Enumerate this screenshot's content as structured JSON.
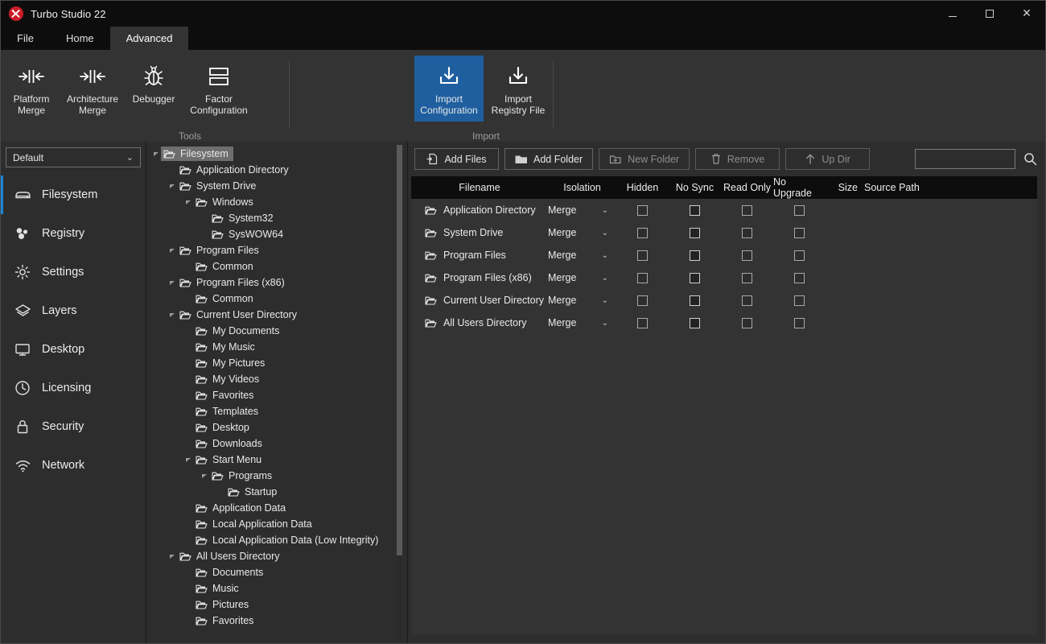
{
  "window": {
    "title": "Turbo Studio 22",
    "app_icon": "turbo-studio-icon",
    "controls": {
      "minimize": "minimize",
      "maximize": "maximize",
      "close": "close"
    }
  },
  "tabs": [
    {
      "label": "File",
      "active": false
    },
    {
      "label": "Home",
      "active": false
    },
    {
      "label": "Advanced",
      "active": true
    }
  ],
  "ribbon": {
    "groups": [
      {
        "label": "Tools",
        "buttons": [
          {
            "label_line1": "Platform",
            "label_line2": "Merge",
            "icon": "merge-icon",
            "selected": false
          },
          {
            "label_line1": "Architecture",
            "label_line2": "Merge",
            "icon": "merge-icon",
            "selected": false
          },
          {
            "label_line1": "Debugger",
            "label_line2": "",
            "icon": "bug-icon",
            "selected": false
          },
          {
            "label_line1": "Factor",
            "label_line2": "Configuration",
            "icon": "factor-icon",
            "selected": false
          }
        ]
      },
      {
        "label": "Import",
        "buttons": [
          {
            "label_line1": "Import",
            "label_line2": "Configuration",
            "icon": "import-icon",
            "selected": true
          },
          {
            "label_line1": "Import",
            "label_line2": "Registry File",
            "icon": "import-icon",
            "selected": false
          }
        ]
      }
    ]
  },
  "sidebar": {
    "profile": {
      "value": "Default",
      "caret": "chevron-down-icon"
    },
    "items": [
      {
        "label": "Filesystem",
        "icon": "drive-icon",
        "active": true
      },
      {
        "label": "Registry",
        "icon": "registry-icon",
        "active": false
      },
      {
        "label": "Settings",
        "icon": "gear-icon",
        "active": false
      },
      {
        "label": "Layers",
        "icon": "layers-icon",
        "active": false
      },
      {
        "label": "Desktop",
        "icon": "monitor-icon",
        "active": false
      },
      {
        "label": "Licensing",
        "icon": "clock-icon",
        "active": false
      },
      {
        "label": "Security",
        "icon": "lock-icon",
        "active": false
      },
      {
        "label": "Network",
        "icon": "wifi-icon",
        "active": false
      }
    ]
  },
  "tree": {
    "nodes": [
      {
        "label": "Filesystem",
        "depth": 0,
        "expander": "expanded",
        "selected": true
      },
      {
        "label": "Application Directory",
        "depth": 1,
        "expander": "none",
        "selected": false
      },
      {
        "label": "System Drive",
        "depth": 1,
        "expander": "expanded",
        "selected": false
      },
      {
        "label": "Windows",
        "depth": 2,
        "expander": "expanded",
        "selected": false
      },
      {
        "label": "System32",
        "depth": 3,
        "expander": "none",
        "selected": false
      },
      {
        "label": "SysWOW64",
        "depth": 3,
        "expander": "none",
        "selected": false
      },
      {
        "label": "Program Files",
        "depth": 1,
        "expander": "expanded",
        "selected": false
      },
      {
        "label": "Common",
        "depth": 2,
        "expander": "none",
        "selected": false
      },
      {
        "label": "Program Files (x86)",
        "depth": 1,
        "expander": "expanded",
        "selected": false
      },
      {
        "label": "Common",
        "depth": 2,
        "expander": "none",
        "selected": false
      },
      {
        "label": "Current User Directory",
        "depth": 1,
        "expander": "expanded",
        "selected": false
      },
      {
        "label": "My Documents",
        "depth": 2,
        "expander": "none",
        "selected": false
      },
      {
        "label": "My Music",
        "depth": 2,
        "expander": "none",
        "selected": false
      },
      {
        "label": "My Pictures",
        "depth": 2,
        "expander": "none",
        "selected": false
      },
      {
        "label": "My Videos",
        "depth": 2,
        "expander": "none",
        "selected": false
      },
      {
        "label": "Favorites",
        "depth": 2,
        "expander": "none",
        "selected": false
      },
      {
        "label": "Templates",
        "depth": 2,
        "expander": "none",
        "selected": false
      },
      {
        "label": "Desktop",
        "depth": 2,
        "expander": "none",
        "selected": false
      },
      {
        "label": "Downloads",
        "depth": 2,
        "expander": "none",
        "selected": false
      },
      {
        "label": "Start Menu",
        "depth": 2,
        "expander": "expanded",
        "selected": false
      },
      {
        "label": "Programs",
        "depth": 3,
        "expander": "expanded",
        "selected": false
      },
      {
        "label": "Startup",
        "depth": 4,
        "expander": "none",
        "selected": false
      },
      {
        "label": "Application Data",
        "depth": 2,
        "expander": "none",
        "selected": false
      },
      {
        "label": "Local Application Data",
        "depth": 2,
        "expander": "none",
        "selected": false
      },
      {
        "label": "Local Application Data (Low Integrity)",
        "depth": 2,
        "expander": "none",
        "selected": false
      },
      {
        "label": "All Users Directory",
        "depth": 1,
        "expander": "expanded",
        "selected": false
      },
      {
        "label": "Documents",
        "depth": 2,
        "expander": "none",
        "selected": false
      },
      {
        "label": "Music",
        "depth": 2,
        "expander": "none",
        "selected": false
      },
      {
        "label": "Pictures",
        "depth": 2,
        "expander": "none",
        "selected": false
      },
      {
        "label": "Favorites",
        "depth": 2,
        "expander": "none",
        "selected": false
      }
    ]
  },
  "toolbar": {
    "buttons": [
      {
        "label": "Add Files",
        "icon": "add-file-icon",
        "disabled": false
      },
      {
        "label": "Add Folder",
        "icon": "add-folder-icon",
        "disabled": false
      },
      {
        "label": "New Folder",
        "icon": "new-folder-icon",
        "disabled": true
      },
      {
        "label": "Remove",
        "icon": "trash-icon",
        "disabled": true
      },
      {
        "label": "Up Dir",
        "icon": "arrow-up-icon",
        "disabled": true
      }
    ],
    "search": {
      "value": "",
      "placeholder": "",
      "icon": "search-icon"
    }
  },
  "grid": {
    "columns": [
      "Filename",
      "Isolation",
      "Hidden",
      "No Sync",
      "Read Only",
      "No Upgrade",
      "Size",
      "Source Path"
    ],
    "rows": [
      {
        "filename": "Application Directory",
        "isolation": "Merge",
        "hidden": false,
        "no_sync": false,
        "read_only": false,
        "no_upgrade": false,
        "size": "",
        "source_path": ""
      },
      {
        "filename": "System Drive",
        "isolation": "Merge",
        "hidden": false,
        "no_sync": false,
        "read_only": false,
        "no_upgrade": false,
        "size": "",
        "source_path": ""
      },
      {
        "filename": "Program Files",
        "isolation": "Merge",
        "hidden": false,
        "no_sync": false,
        "read_only": false,
        "no_upgrade": false,
        "size": "",
        "source_path": ""
      },
      {
        "filename": "Program Files (x86)",
        "isolation": "Merge",
        "hidden": false,
        "no_sync": false,
        "read_only": false,
        "no_upgrade": false,
        "size": "",
        "source_path": ""
      },
      {
        "filename": "Current User Directory",
        "isolation": "Merge",
        "hidden": false,
        "no_sync": false,
        "read_only": false,
        "no_upgrade": false,
        "size": "",
        "source_path": ""
      },
      {
        "filename": "All Users Directory",
        "isolation": "Merge",
        "hidden": false,
        "no_sync": false,
        "read_only": false,
        "no_upgrade": false,
        "size": "",
        "source_path": ""
      }
    ]
  },
  "colors": {
    "accent_blue": "#1f5fa0",
    "nav_accent": "#1b84d8",
    "titlebar_bg": "#0d0d0d",
    "ribbon_bg": "#333333",
    "panel_bg": "#2d2d2d",
    "grid_header_bg": "#0d0d0d"
  }
}
